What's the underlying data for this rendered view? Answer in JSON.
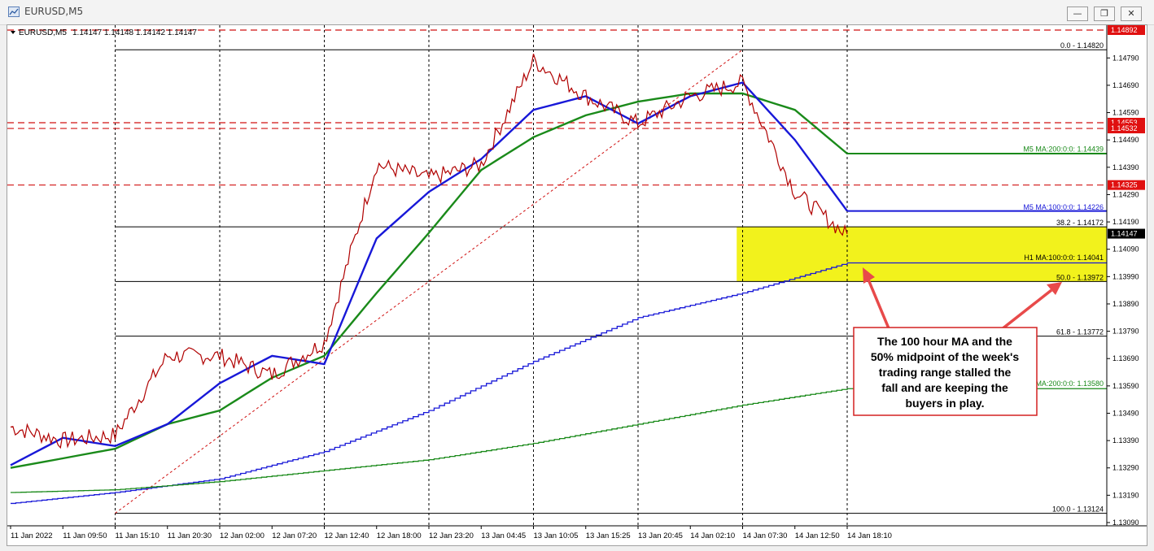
{
  "window": {
    "title": "EURUSD,M5",
    "minimize_label": "—",
    "restore_label": "❐",
    "close_label": "✕"
  },
  "header": {
    "symbol_text": "EURUSD,M5",
    "ohlc_text": "1.14147 1.14148 1.14142 1.14147"
  },
  "annotation": {
    "text_lines": [
      "The 100 hour MA and the",
      "50% midpoint of the week's",
      "trading range stalled the",
      "fall and are keeping the",
      "buyers in play."
    ]
  },
  "colors": {
    "ma_blue": "#1818d8",
    "ma_green": "#1a8a1a",
    "candle": "#b00000",
    "red_line": "#d01010",
    "zone": "#f2f21c",
    "label_bg": "#e01010",
    "current_bg": "#000000"
  },
  "chart_data": {
    "type": "line",
    "symbol": "EURUSD",
    "timeframe": "M5",
    "ylim": [
      1.1309,
      1.14892
    ],
    "y_ticks": [
      "1.14790",
      "1.14690",
      "1.14590",
      "1.14490",
      "1.14390",
      "1.14290",
      "1.14190",
      "1.14090",
      "1.13990",
      "1.13890",
      "1.13790",
      "1.13690",
      "1.13590",
      "1.13490",
      "1.13390",
      "1.13290",
      "1.13190",
      "1.13090"
    ],
    "x_ticks": [
      "11 Jan 2022",
      "11 Jan 09:50",
      "11 Jan 15:10",
      "11 Jan 20:30",
      "12 Jan 02:00",
      "12 Jan 07:20",
      "12 Jan 12:40",
      "12 Jan 18:00",
      "12 Jan 23:20",
      "13 Jan 04:45",
      "13 Jan 10:05",
      "13 Jan 15:25",
      "13 Jan 20:45",
      "14 Jan 02:10",
      "14 Jan 07:30",
      "14 Jan 12:50",
      "14 Jan 18:10"
    ],
    "vertical_grid_ticks": [
      "11 Jan 15:10",
      "12 Jan 02:00",
      "12 Jan 12:40",
      "12 Jan 23:20",
      "13 Jan 10:05",
      "13 Jan 20:45",
      "14 Jan 07:30",
      "14 Jan 18:10"
    ],
    "price_series": {
      "name": "EURUSD",
      "x": [
        "11 Jan 2022",
        "11 Jan 09:50",
        "11 Jan 15:10",
        "11 Jan 20:30",
        "12 Jan 02:00",
        "12 Jan 07:20",
        "12 Jan 12:40",
        "12 Jan 18:00",
        "12 Jan 23:20",
        "13 Jan 04:45",
        "13 Jan 10:05",
        "13 Jan 15:25",
        "13 Jan 20:45",
        "14 Jan 02:10",
        "14 Jan 07:30",
        "14 Jan 12:50",
        "14 Jan 18:10"
      ],
      "values": [
        1.1344,
        1.1339,
        1.1341,
        1.137,
        1.137,
        1.1363,
        1.1375,
        1.144,
        1.1435,
        1.144,
        1.1478,
        1.1465,
        1.1455,
        1.1465,
        1.147,
        1.143,
        1.1414
      ]
    },
    "ma_series": [
      {
        "name": "M5 MA:200:0:0",
        "color": "#1a8a1a",
        "last_value": 1.14439,
        "x": [
          "11 Jan 2022",
          "11 Jan 15:10",
          "11 Jan 20:30",
          "12 Jan 02:00",
          "12 Jan 07:20",
          "12 Jan 12:40",
          "12 Jan 18:00",
          "12 Jan 23:20",
          "13 Jan 04:45",
          "13 Jan 10:05",
          "13 Jan 15:25",
          "13 Jan 20:45",
          "14 Jan 02:10",
          "14 Jan 07:30",
          "14 Jan 12:50",
          "14 Jan 18:10"
        ],
        "values": [
          1.1329,
          1.1336,
          1.1345,
          1.135,
          1.1362,
          1.137,
          1.1393,
          1.1415,
          1.1438,
          1.145,
          1.1458,
          1.1463,
          1.1466,
          1.1466,
          1.146,
          1.1444
        ]
      },
      {
        "name": "M5 MA:100:0:0",
        "color": "#1818d8",
        "last_value": 1.14226,
        "x": [
          "11 Jan 2022",
          "11 Jan 09:50",
          "11 Jan 15:10",
          "11 Jan 20:30",
          "12 Jan 02:00",
          "12 Jan 07:20",
          "12 Jan 12:40",
          "12 Jan 18:00",
          "12 Jan 23:20",
          "13 Jan 04:45",
          "13 Jan 10:05",
          "13 Jan 15:25",
          "13 Jan 20:45",
          "14 Jan 02:10",
          "14 Jan 07:30",
          "14 Jan 12:50",
          "14 Jan 18:10"
        ],
        "values": [
          1.133,
          1.134,
          1.1337,
          1.1345,
          1.136,
          1.137,
          1.1367,
          1.1413,
          1.143,
          1.1442,
          1.146,
          1.1465,
          1.1455,
          1.1465,
          1.147,
          1.1449,
          1.1423
        ]
      },
      {
        "name": "H1 MA:100:0:0",
        "color": "#1818d8",
        "last_value": 1.14041,
        "x": [
          "11 Jan 2022",
          "11 Jan 15:10",
          "12 Jan 02:00",
          "12 Jan 12:40",
          "12 Jan 23:20",
          "13 Jan 10:05",
          "13 Jan 20:45",
          "14 Jan 07:30",
          "14 Jan 18:10"
        ],
        "values": [
          1.1316,
          1.132,
          1.1325,
          1.1335,
          1.135,
          1.1368,
          1.1384,
          1.1393,
          1.1404
        ]
      },
      {
        "name": "H1 MA:200:0:0",
        "color": "#1a8a1a",
        "last_value": 1.1358,
        "x": [
          "11 Jan 2022",
          "11 Jan 15:10",
          "12 Jan 02:00",
          "12 Jan 12:40",
          "12 Jan 23:20",
          "13 Jan 10:05",
          "13 Jan 20:45",
          "14 Jan 07:30",
          "14 Jan 18:10"
        ],
        "values": [
          1.132,
          1.1321,
          1.1324,
          1.1328,
          1.1332,
          1.1338,
          1.1345,
          1.1352,
          1.1358
        ]
      }
    ],
    "fib_levels": [
      {
        "label": "0.0 - 1.14820",
        "value": 1.1482
      },
      {
        "label": "38.2 - 1.14172",
        "value": 1.14172
      },
      {
        "label": "50.0 - 1.13972",
        "value": 1.13972
      },
      {
        "label": "61.8 - 1.13772",
        "value": 1.13772
      },
      {
        "label": "100.0 - 1.13124",
        "value": 1.13124
      }
    ],
    "fib_trendline": {
      "from": {
        "time": "11 Jan 15:10",
        "price": 1.13124
      },
      "to": {
        "time": "14 Jan 07:30",
        "price": 1.1482
      }
    },
    "horizontal_levels": [
      {
        "label": "1.14892",
        "value": 1.14892
      },
      {
        "label": "1.14553",
        "value": 1.14553
      },
      {
        "label": "1.14532",
        "value": 1.14532
      },
      {
        "label": "1.14325",
        "value": 1.14325
      }
    ],
    "zone": {
      "low": 1.13972,
      "high": 1.14172,
      "from_time": "14 Jan 02:10"
    },
    "current_price": {
      "label": "1.14147",
      "value": 1.14147
    },
    "ma_labels": [
      {
        "text": "M5 MA:200:0:0: 1.14439",
        "value": 1.14439,
        "color": "#1a8a1a"
      },
      {
        "text": "M5 MA:100:0:0: 1.14226",
        "value": 1.14226,
        "color": "#1818d8"
      },
      {
        "text": "H1 MA:100:0:0: 1.14041",
        "value": 1.14041,
        "color": "#000000"
      },
      {
        "text": "MA:200:0:0: 1.13580",
        "value": 1.1358,
        "color": "#1a8a1a"
      }
    ]
  }
}
